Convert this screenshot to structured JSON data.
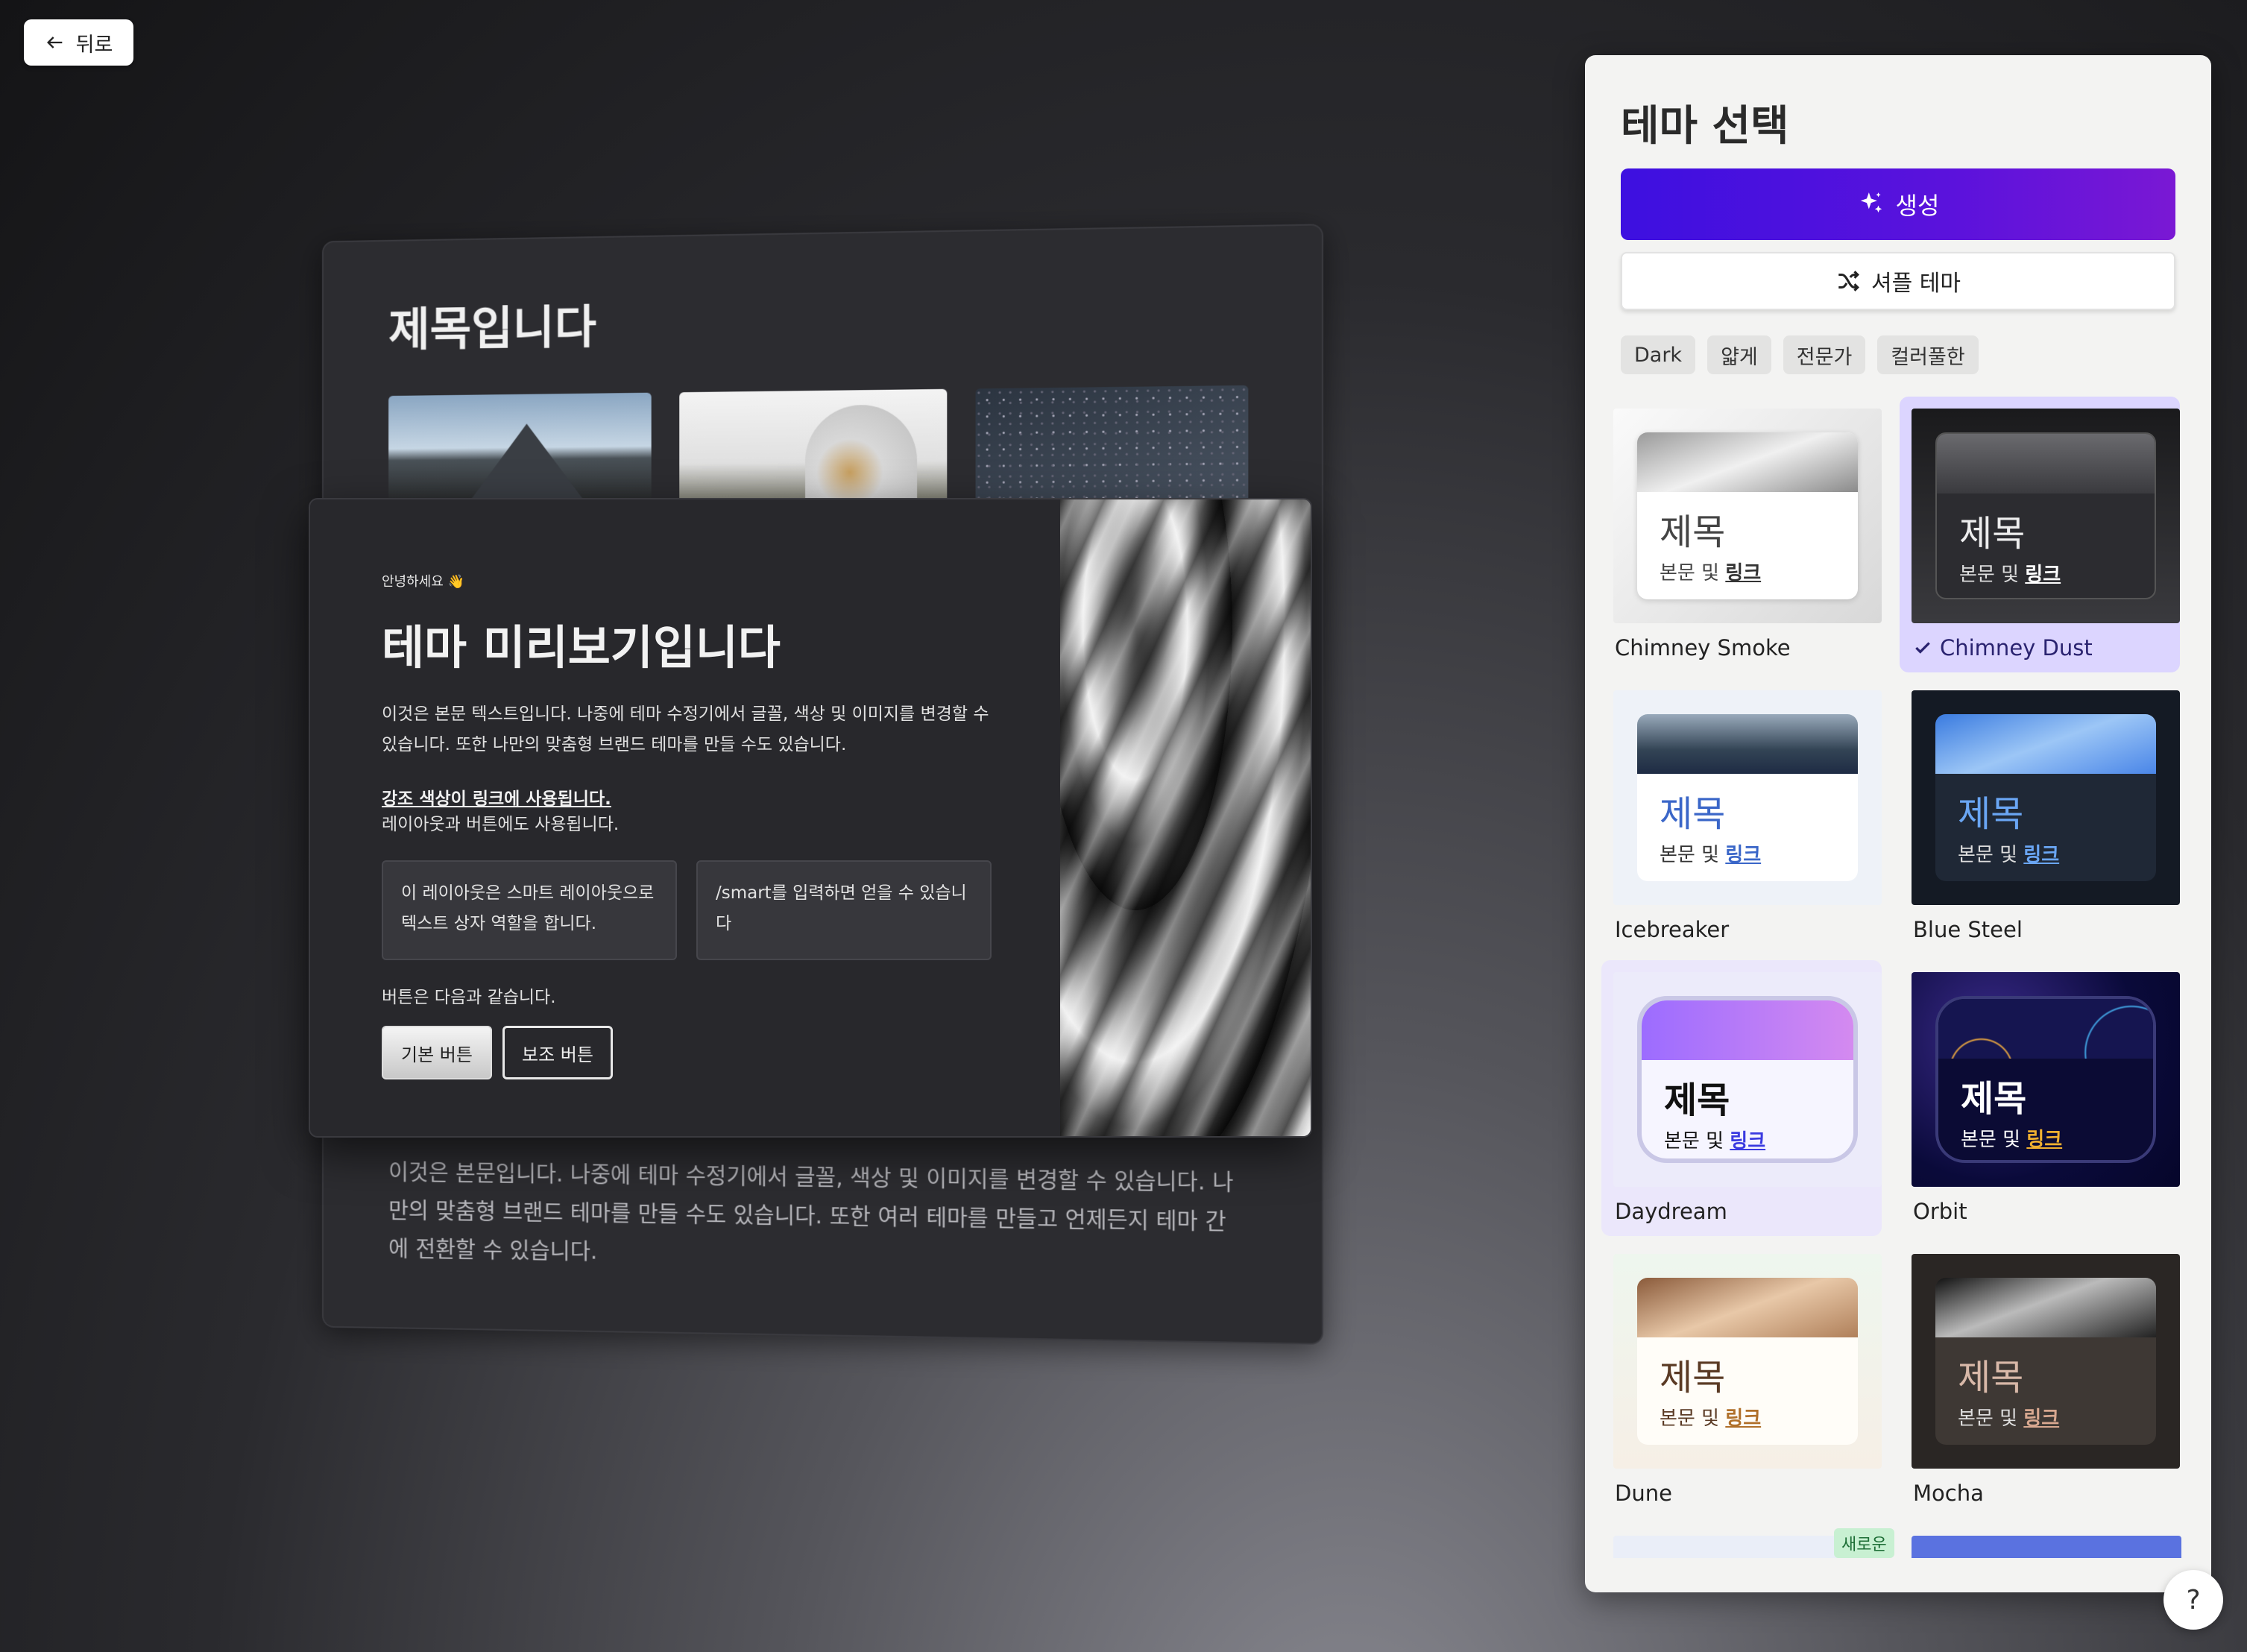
{
  "back_label": "뒤로",
  "slide_back": {
    "title": "제목입니다",
    "body": "이것은 본문입니다. 나중에 테마 수정기에서 글꼴, 색상 및 이미지를 변경할 수 있습니다. 나만의 맞춤형 브랜드 테마를 만들 수도 있습니다. 또한 여러 테마를 만들고 언제든지 테마 간에 전환할 수 있습니다."
  },
  "slide_front": {
    "greeting": "안녕하세요 👋",
    "title": "테마 미리보기입니다",
    "body": "이것은 본문 텍스트입니다. 나중에 테마 수정기에서 글꼴, 색상 및 이미지를 변경할 수 있습니다. 또한 나만의 맞춤형 브랜드 테마를 만들 수도 있습니다.",
    "accent_link": "강조 색상이 링크에 사용됩니다.",
    "accent_sub": "레이아웃과 버튼에도 사용됩니다.",
    "box1": "이 레이아웃은 스마트 레이아웃으로 텍스트 상자 역할을 합니다.",
    "box2": "/smart를 입력하면 얻을 수 있습니다",
    "buttons_caption": "버튼은 다음과 같습니다.",
    "primary_button": "기본 버튼",
    "secondary_button": "보조 버튼"
  },
  "panel": {
    "title": "테마 선택",
    "generate_label": "생성",
    "shuffle_label": "셔플 테마",
    "chips": [
      "Dark",
      "얇게",
      "전문가",
      "컬러풀한"
    ],
    "card_title": "제목",
    "card_body": "본문 및",
    "card_link": "링크",
    "themes": [
      {
        "name": "Chimney Smoke"
      },
      {
        "name": "Chimney Dust",
        "selected": true
      },
      {
        "name": "Icebreaker"
      },
      {
        "name": "Blue Steel"
      },
      {
        "name": "Daydream"
      },
      {
        "name": "Orbit"
      },
      {
        "name": "Dune"
      },
      {
        "name": "Mocha"
      }
    ],
    "new_badge": "새로운"
  },
  "help_label": "?"
}
